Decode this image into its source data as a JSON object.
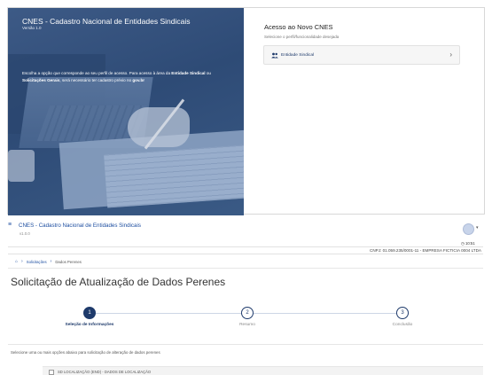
{
  "login": {
    "title": "CNES - Cadastro Nacional de Entidades Sindicais",
    "version": "Versão 1.0",
    "intro_prefix": "Escolha a opção que corresponde ao seu perfil de acesso. Para acesso à área da ",
    "intro_bold1": "Entidade Sindical",
    "intro_mid": " ou ",
    "intro_bold2": "Solicitações Gerais",
    "intro_suffix": ", será necessário ter cadastro prévio no ",
    "intro_bold3": "gov.br",
    "access_title": "Acesso ao Novo CNES",
    "access_subtitle": "Selecione o perfil/funcionalidade desejada",
    "entity_option": "Entidade Sindical",
    "icons": {
      "entity": "users-icon",
      "chevron": "chevron-right-icon"
    }
  },
  "header": {
    "menu_icon": "≡",
    "title": "CNES - Cadastro Nacional de Entidades Sindicais",
    "version": "v1.0.0",
    "time": "10:51",
    "cnpj_line": "CNPJ: 01.059.235/0001-11 - EMPRESA FICTICIA 0004 LTDA"
  },
  "breadcrumb": {
    "items": [
      "Solicitações",
      "Dados Perenes"
    ]
  },
  "page": {
    "title": "Solicitação de Atualização de Dados Perenes"
  },
  "stepper": {
    "steps": [
      {
        "number": "1",
        "label": "Seleção de Informações",
        "state": "active"
      },
      {
        "number": "2",
        "label": "Resumo",
        "state": "idle"
      },
      {
        "number": "3",
        "label": "Conclusão",
        "state": "idle"
      }
    ]
  },
  "selection": {
    "instruction": "Selecione uma ou mais opções abaixo para solicitação de alteração de dados perenes",
    "options": [
      "SD LOCALIZAÇÃO (END) - DADOS DE LOCALIZAÇÃO"
    ]
  },
  "colors": {
    "primary": "#1e3a6b",
    "link": "#1d4ea0",
    "hero": "#2e4b76"
  }
}
